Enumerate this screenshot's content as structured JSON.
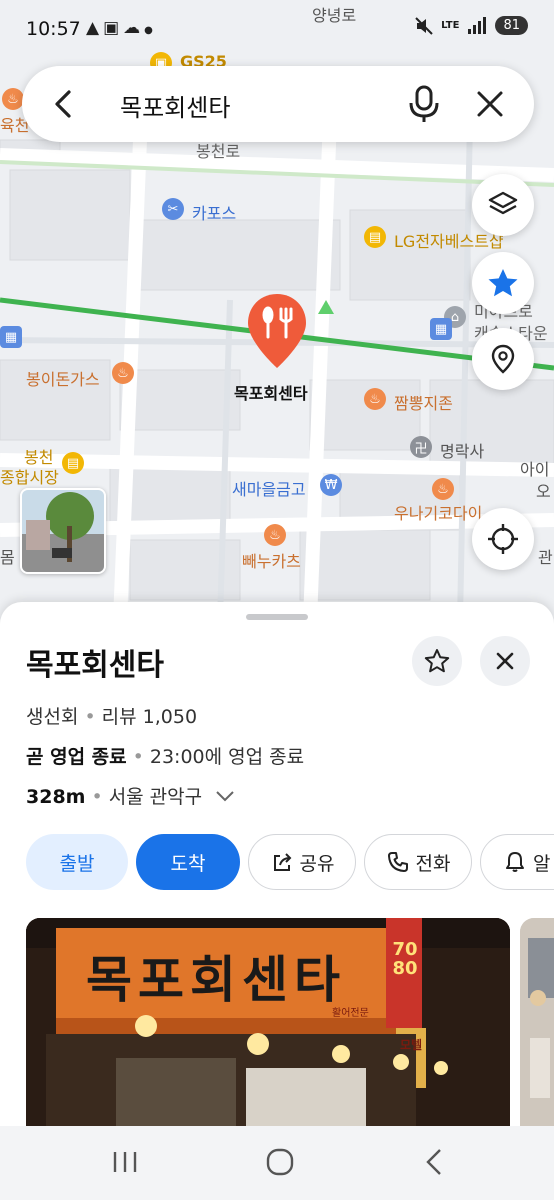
{
  "status_bar": {
    "time": "10:57",
    "battery": "81",
    "network": "LTE"
  },
  "search": {
    "query": "목포회센타"
  },
  "map": {
    "labels": {
      "gs25": "GS25",
      "yangnyeongro": "양녕로",
      "bongcheonro": "봉천로",
      "kapos": "카포스",
      "lg": "LG전자베스트샵",
      "mia": "미아트로",
      "castle": "캐슬스타운",
      "bongidon": "봉이돈가스",
      "selected": "목포회센타",
      "jjambbong": "짬뽕지존",
      "myeongraksa": "명락사",
      "bongcheon_market_1": "봉천",
      "bongcheon_market_2": "종합시장",
      "saemaeul": "새마을금고",
      "unagi": "우나기코다이",
      "ppanu": "빼누카츠",
      "aika": "아이",
      "yukcheon": "육천",
      "gwan": "관",
      "o": "오",
      "mok": "몸"
    }
  },
  "place": {
    "name": "목포회센타",
    "category": "생선회",
    "reviews": "리뷰 1,050",
    "hours_status": "곧 영업 종료",
    "hours_detail": "23:00에 영업 종료",
    "distance": "328m",
    "region": "서울 관악구"
  },
  "actions": {
    "depart": "출발",
    "arrive": "도착",
    "share": "공유",
    "call": "전화",
    "alarm": "알"
  },
  "photo": {
    "sign_text": "목포회센타",
    "side_sign": "7080",
    "side_sign_2": "모텔",
    "sub_sign": "활어전문"
  },
  "colors": {
    "primary_blue": "#1a73e8",
    "light_blue": "#e3efff",
    "route_green": "#3fb34f",
    "pin_red": "#ef5b3a",
    "poi_orange": "#f08a4b"
  }
}
